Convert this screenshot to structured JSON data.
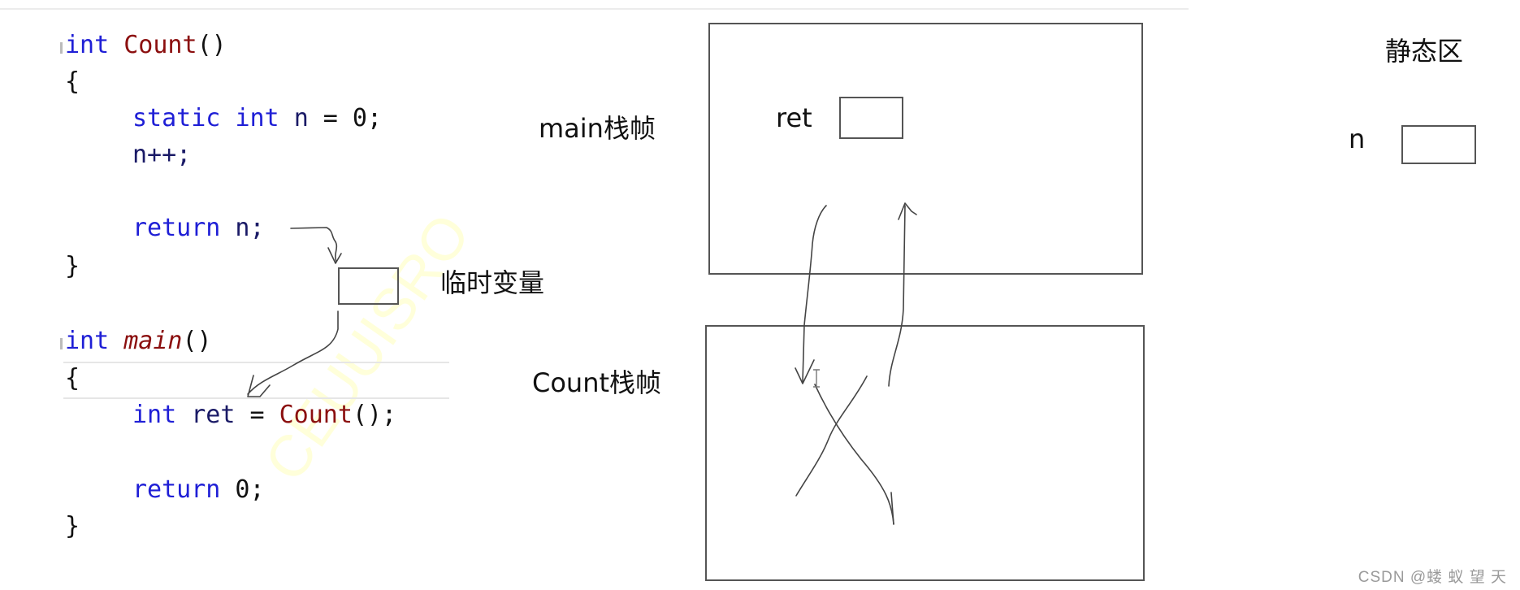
{
  "code": {
    "count_func": {
      "signature": {
        "type": "int",
        "name": "Count",
        "parens": "()"
      },
      "open_brace": "{",
      "line1": {
        "kw1": "static",
        "kw2": "int",
        "var": "n",
        "rest": " = 0;"
      },
      "line2": "n++;",
      "line3": {
        "kw": "return",
        "rest": " n;"
      },
      "close_brace": "}"
    },
    "main_func": {
      "signature": {
        "type": "int",
        "name": "main",
        "parens": "()"
      },
      "open_brace": "{",
      "line1": {
        "kw": "int",
        "var": "ret",
        "eq": " = ",
        "call": "Count",
        "rest": "();"
      },
      "line2": {
        "kw": "return",
        "rest": " 0;"
      },
      "close_brace": "}"
    }
  },
  "labels": {
    "temp_variable": "临时变量",
    "main_frame": "main栈帧",
    "count_frame": "Count栈帧",
    "static_area": "静态区",
    "ret_var": "ret",
    "n_var": "n"
  },
  "watermark": "CSDN @蝼 蚁 望 天",
  "faint_watermark": "CEUUISRO"
}
